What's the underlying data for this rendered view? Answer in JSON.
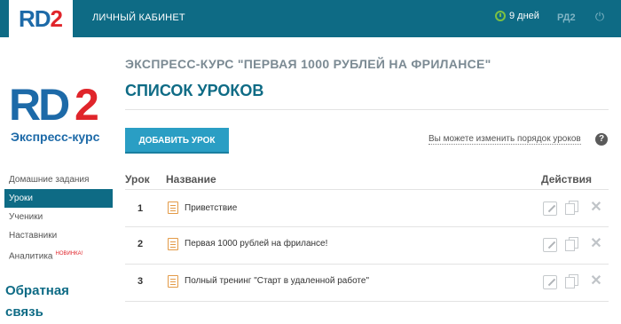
{
  "header": {
    "logo_text_rd": "RD",
    "logo_text_2": "2",
    "cabinet_link": "ЛИЧНЫЙ КАБИНЕТ",
    "days_left": "9 дней",
    "user_code": "РД2",
    "clock_icon": "clock-icon",
    "power_icon": "power-icon",
    "accent_color": "#0e6b85"
  },
  "sidebar": {
    "logo_rd": "RD",
    "logo_2": "2",
    "logo_subtitle": "Экспресс-курс",
    "items": [
      {
        "label": "Домашние задания",
        "active": false
      },
      {
        "label": "Уроки",
        "active": true
      },
      {
        "label": "Ученики",
        "active": false
      },
      {
        "label": "Наставники",
        "active": false
      },
      {
        "label": "Аналитика",
        "active": false,
        "badge": "НОВИНКА!"
      }
    ],
    "feedback_label": "Обратная связь"
  },
  "main": {
    "course_title": "ЭКСПРЕСС-КУРС \"ПЕРВАЯ 1000 РУБЛЕЙ НА ФРИЛАНСЕ\"",
    "page_title": "СПИСОК УРОКОВ",
    "add_button": "ДОБАВИТЬ УРОК",
    "order_hint": "Вы можете изменить порядок уроков",
    "help_icon": "?",
    "table": {
      "headers": {
        "num": "Урок",
        "name": "Название",
        "actions": "Действия"
      },
      "rows": [
        {
          "num": "1",
          "name": "Приветствие"
        },
        {
          "num": "2",
          "name": "Первая 1000 рублей на фрилансе!"
        },
        {
          "num": "3",
          "name": "Полный тренинг \"Старт в удаленной работе\""
        }
      ]
    }
  }
}
